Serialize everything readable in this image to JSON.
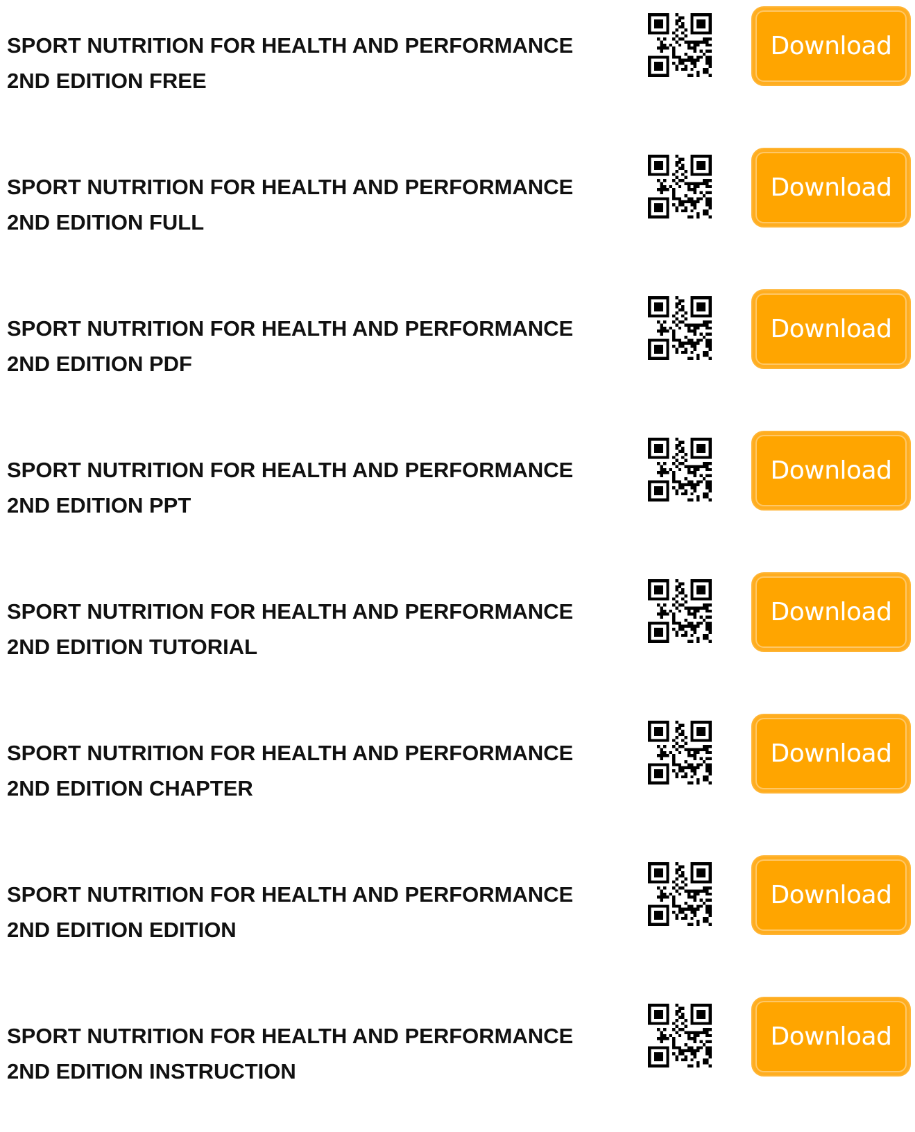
{
  "colors": {
    "button_bg": "#ffa500",
    "button_text": "#ffffff",
    "title_text": "#111111"
  },
  "icons": {
    "qr": "qr-code-icon"
  },
  "items": [
    {
      "title_line1": "SPORT NUTRITION FOR HEALTH AND PERFORMANCE",
      "title_line2": "2ND EDITION FREE",
      "button_label": "Download"
    },
    {
      "title_line1": "SPORT NUTRITION FOR HEALTH AND PERFORMANCE",
      "title_line2": "2ND EDITION FULL",
      "button_label": "Download"
    },
    {
      "title_line1": "SPORT NUTRITION FOR HEALTH AND PERFORMANCE",
      "title_line2": "2ND EDITION PDF",
      "button_label": "Download"
    },
    {
      "title_line1": "SPORT NUTRITION FOR HEALTH AND PERFORMANCE",
      "title_line2": "2ND EDITION PPT",
      "button_label": "Download"
    },
    {
      "title_line1": "SPORT NUTRITION FOR HEALTH AND PERFORMANCE",
      "title_line2": "2ND EDITION TUTORIAL",
      "button_label": "Download"
    },
    {
      "title_line1": "SPORT NUTRITION FOR HEALTH AND PERFORMANCE",
      "title_line2": "2ND EDITION CHAPTER",
      "button_label": "Download"
    },
    {
      "title_line1": "SPORT NUTRITION FOR HEALTH AND PERFORMANCE",
      "title_line2": "2ND EDITION EDITION",
      "button_label": "Download"
    },
    {
      "title_line1": "SPORT NUTRITION FOR HEALTH AND PERFORMANCE",
      "title_line2": "2ND EDITION INSTRUCTION",
      "button_label": "Download"
    }
  ]
}
